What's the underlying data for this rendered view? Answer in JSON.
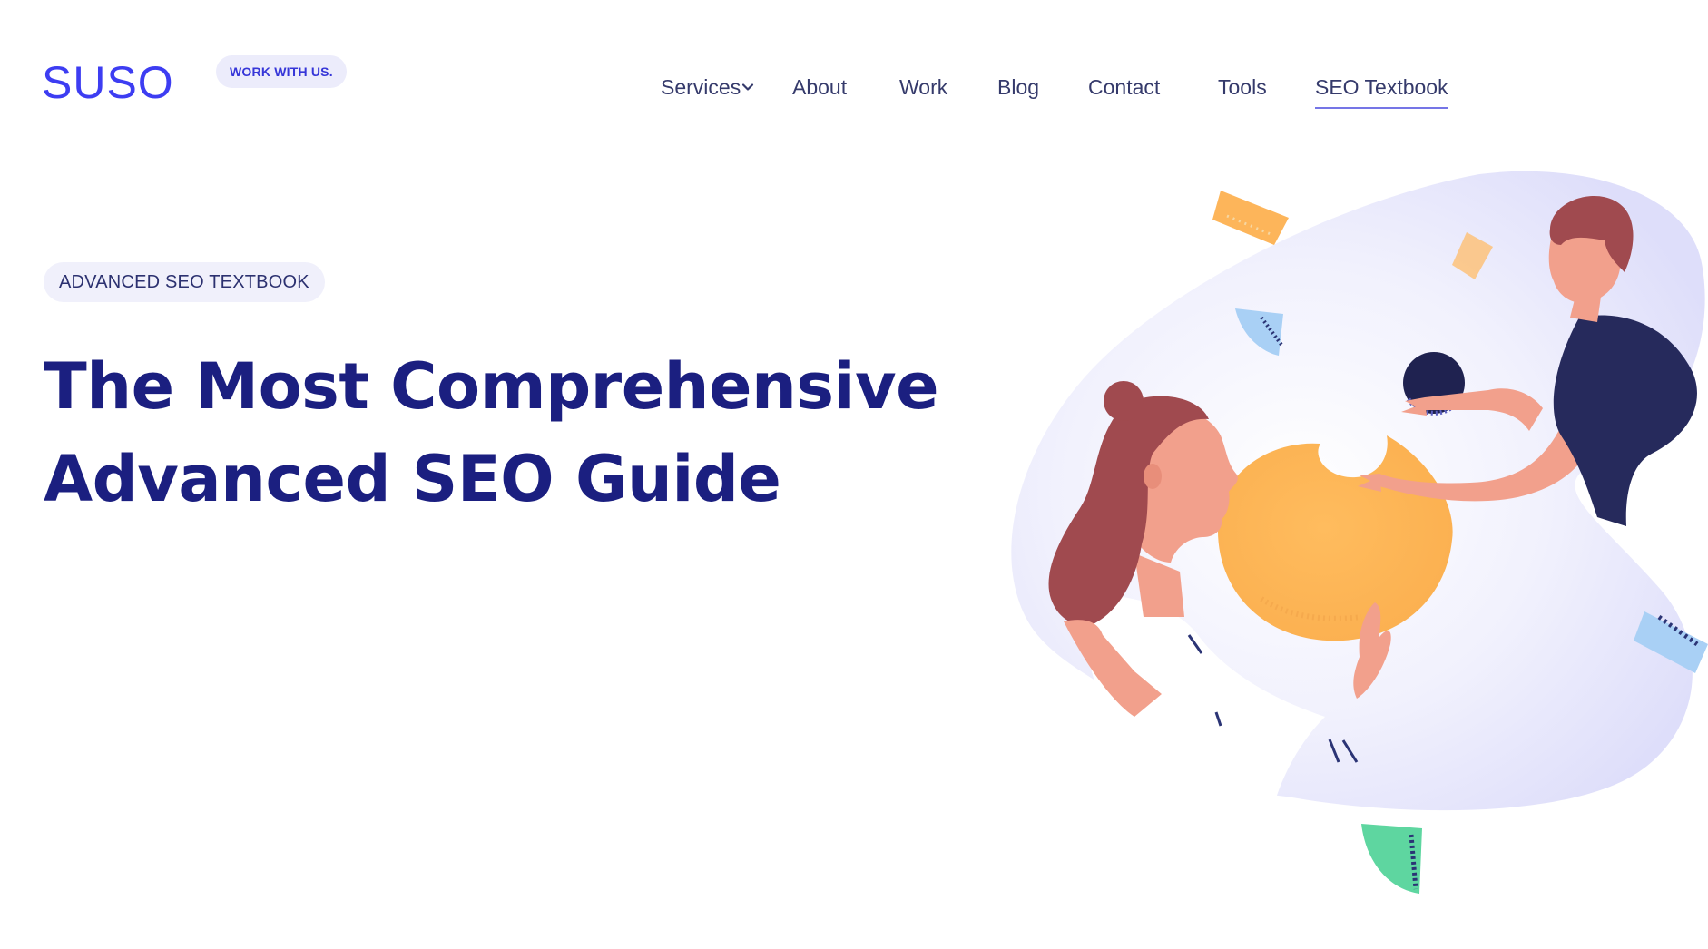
{
  "header": {
    "logo": "SUSO",
    "work_pill": "WORK WITH US.",
    "nav": [
      {
        "label": "Services",
        "has_dropdown": true
      },
      {
        "label": "About"
      },
      {
        "label": "Work"
      },
      {
        "label": "Blog"
      },
      {
        "label": "Contact"
      },
      {
        "label": "Tools"
      },
      {
        "label": "SEO Textbook",
        "active": true
      }
    ]
  },
  "hero": {
    "eyebrow": "ADVANCED SEO TEXTBOOK",
    "title_line1": "The Most Comprehensive",
    "title_line2": "Advanced SEO Guide"
  },
  "colors": {
    "brand_blue": "#3d3df2",
    "title_navy": "#1b1f80",
    "nav_text": "#353a6b",
    "pill_bg": "#ececfb",
    "illustration_blob": "#e9e9fc",
    "orange": "#fdb55a",
    "hair": "#a04a4f",
    "skin": "#f2a08c",
    "shirt_navy": "#262a5c",
    "green": "#5ed6a0",
    "light_blue": "#a9d0f5"
  }
}
